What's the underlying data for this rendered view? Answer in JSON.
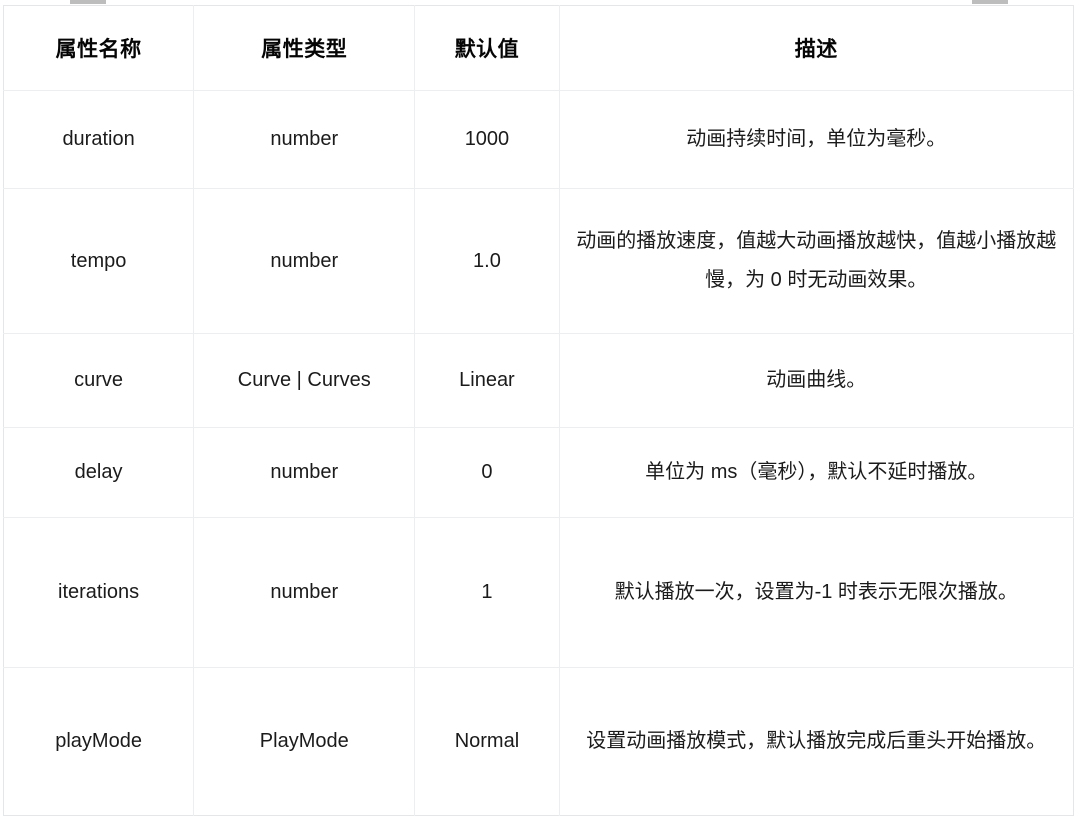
{
  "table": {
    "columns": [
      {
        "key": "name",
        "label": "属性名称"
      },
      {
        "key": "type",
        "label": "属性类型"
      },
      {
        "key": "default",
        "label": "默认值"
      },
      {
        "key": "desc",
        "label": "描述"
      }
    ],
    "rows": [
      {
        "name": "duration",
        "type": "number",
        "default": "1000",
        "desc": "动画持续时间，单位为毫秒。"
      },
      {
        "name": "tempo",
        "type": "number",
        "default": "1.0",
        "desc": "动画的播放速度，值越大动画播放越快，值越小播放越慢，为 0 时无动画效果。"
      },
      {
        "name": "curve",
        "type": "Curve | Curves",
        "default": "Linear",
        "desc": "动画曲线。"
      },
      {
        "name": "delay",
        "type": "number",
        "default": "0",
        "desc": "单位为 ms（毫秒），默认不延时播放。"
      },
      {
        "name": "iterations",
        "type": "number",
        "default": "1",
        "desc": "默认播放一次，设置为-1 时表示无限次播放。"
      },
      {
        "name": "playMode",
        "type": "PlayMode",
        "default": "Normal",
        "desc": "设置动画播放模式，默认播放完成后重头开始播放。"
      }
    ]
  },
  "colors": {
    "text": "#1b1b1b",
    "header_text": "#050505",
    "border": "#eceef0",
    "outer_border": "#e4e6e8",
    "scrollbar": "#bdbdbd",
    "background": "#ffffff"
  }
}
